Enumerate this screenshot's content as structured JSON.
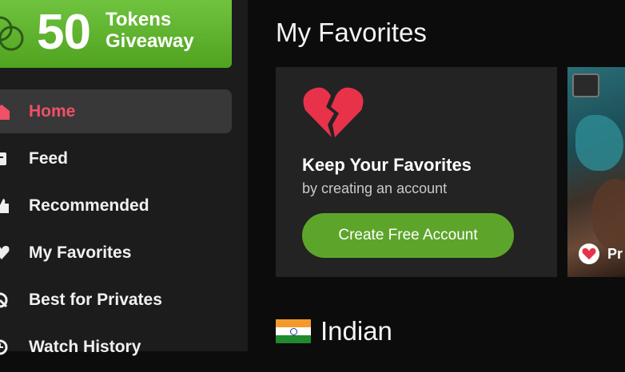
{
  "promo": {
    "number": "50",
    "line1": "Tokens",
    "line2": "Giveaway"
  },
  "nav": {
    "items": [
      {
        "label": "Home",
        "icon": "home-icon",
        "active": true
      },
      {
        "label": "Feed",
        "icon": "feed-icon"
      },
      {
        "label": "Recommended",
        "icon": "thumbs-up-icon"
      },
      {
        "label": "My Favorites",
        "icon": "heart-icon"
      },
      {
        "label": "Best for Privates",
        "icon": "privates-icon"
      },
      {
        "label": "Watch History",
        "icon": "history-icon"
      }
    ]
  },
  "main": {
    "title": "My Favorites",
    "card": {
      "icon": "broken-heart-icon",
      "heading": "Keep Your Favorites",
      "subheading": "by creating an account",
      "button_label": "Create Free Account"
    },
    "thumbnail": {
      "badge_text": "Pr"
    },
    "category": {
      "flag": "india-flag-icon",
      "name": "Indian"
    }
  },
  "colors": {
    "accent": "#5da52a",
    "active": "#f05068",
    "promo": "#5cb42b"
  }
}
